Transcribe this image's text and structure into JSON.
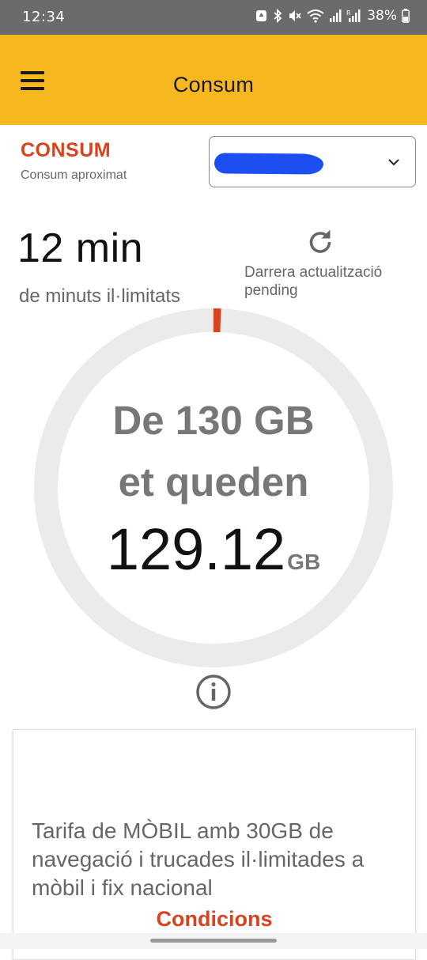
{
  "status_bar": {
    "time": "12:34",
    "battery": "38%",
    "icons": [
      "notification-icon",
      "bluetooth-icon",
      "mute-icon",
      "wifi-icon",
      "signal-icon",
      "roaming-signal-icon",
      "battery-icon"
    ]
  },
  "app_bar": {
    "title": "Consum",
    "menu_icon": "hamburger-menu-icon"
  },
  "consumption": {
    "label": "CONSUM",
    "sublabel": "Consum aproximat",
    "line_select": {
      "selected_value": "[redacted]",
      "icon": "chevron-down-icon"
    }
  },
  "minutes": {
    "value": "12 min",
    "label": "de minuts il·limitats"
  },
  "last_update": {
    "label": "Darrera actualització",
    "value": "pending",
    "icon": "refresh-icon"
  },
  "gauge": {
    "line1": "De 130 GB",
    "line2": "et queden",
    "remaining": "129.12",
    "unit": "GB",
    "total_gb": 130,
    "remaining_gb": 129.12,
    "used_fraction": 0.0068,
    "colors": {
      "track": "#ebebeb",
      "used": "#d9421c"
    }
  },
  "info_icon": "info-icon",
  "tariff": {
    "description": "Tarifa de MÒBIL amb 30GB de navegació i trucades il·limitades a mòbil i fix nacional",
    "link_label": "Condicions"
  },
  "colors": {
    "brand_yellow": "#f7b81f",
    "accent_red": "#d9421c",
    "status_bar": "#6b6b6b"
  }
}
